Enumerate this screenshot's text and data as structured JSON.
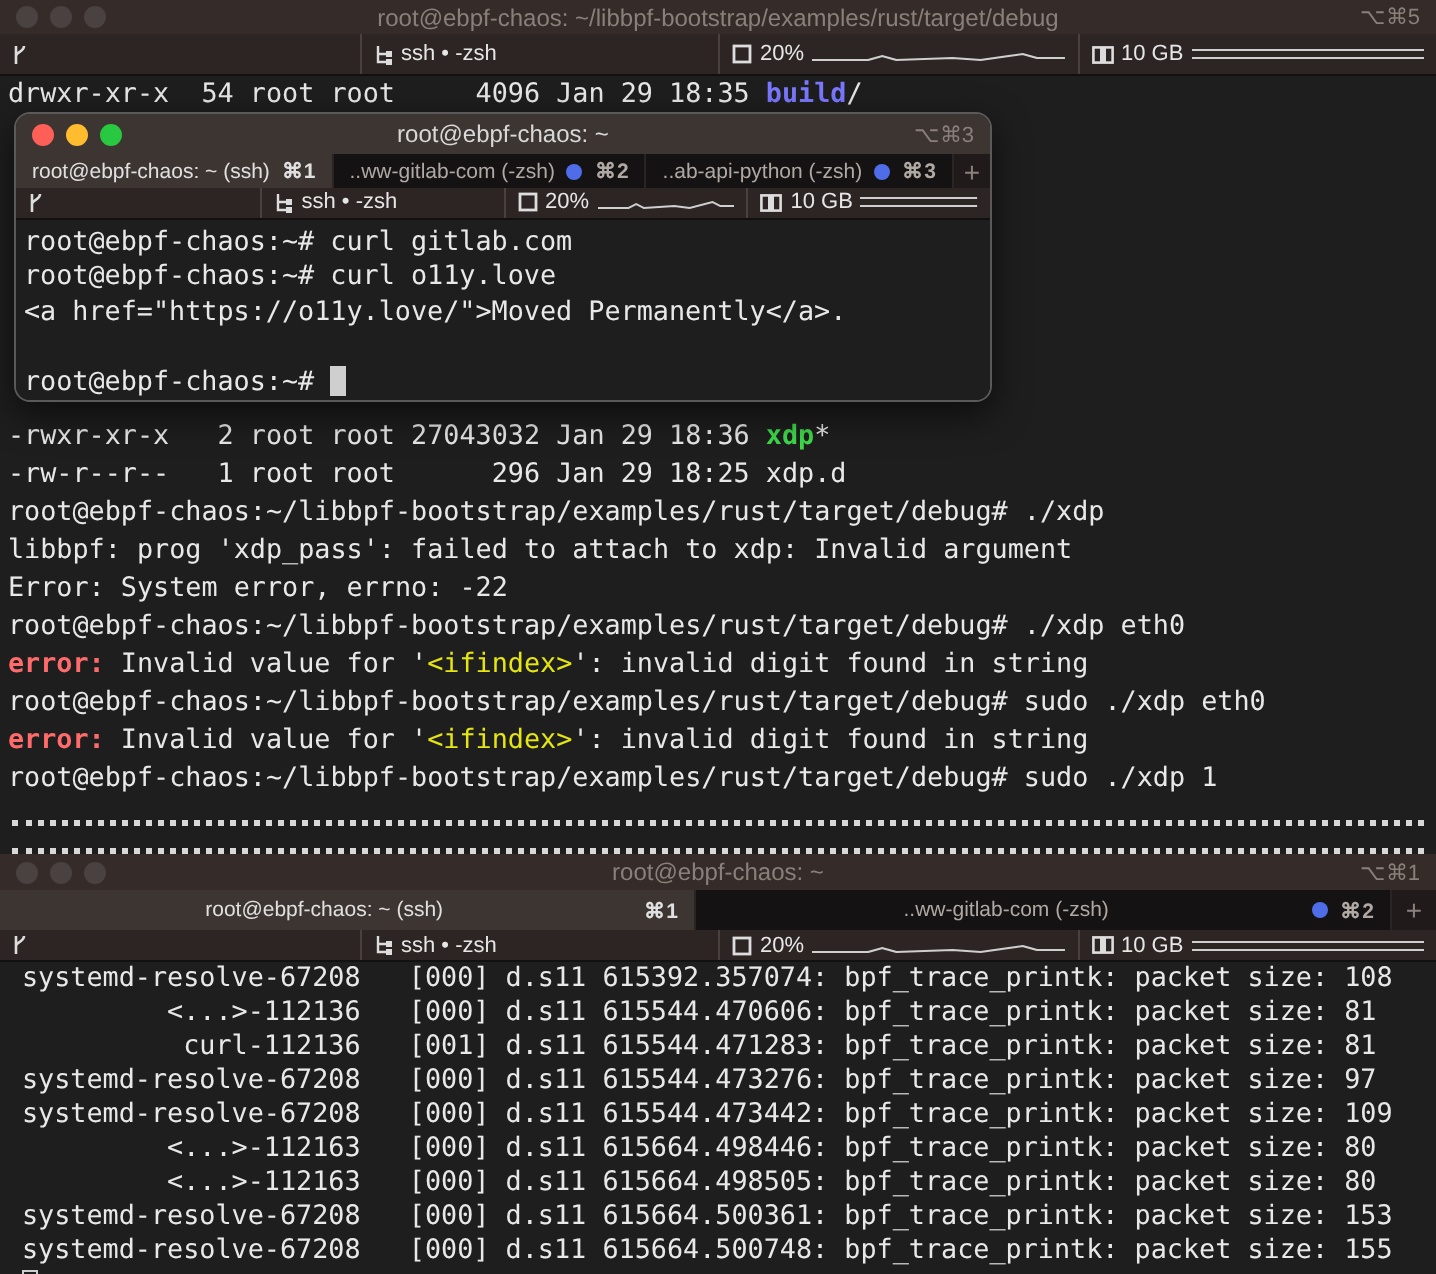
{
  "back_window": {
    "title": "root@ebpf-chaos: ~/libbpf-bootstrap/examples/rust/target/debug",
    "shortcut": "⌥⌘5",
    "focused": false,
    "status_bar": {
      "process": "ssh • -zsh",
      "cpu": "20%",
      "memory": "10 GB"
    },
    "top_lines": [
      [
        {
          "text": "drwxr-xr-x  54 root root     4096 Jan 29 18:35 ",
          "kind": "plain"
        },
        {
          "text": "build",
          "kind": "directory"
        },
        {
          "text": "/",
          "kind": "plain"
        }
      ]
    ],
    "lines": [
      [
        {
          "text": "-rwxr-xr-x   2 root root 27043032 Jan 29 18:36 ",
          "kind": "plain"
        },
        {
          "text": "xdp",
          "kind": "executable"
        },
        {
          "text": "*",
          "kind": "plain"
        }
      ],
      [
        {
          "text": "-rw-r--r--   1 root root      296 Jan 29 18:25 xdp.d",
          "kind": "plain"
        }
      ],
      [
        {
          "text": "root@ebpf-chaos:~/libbpf-bootstrap/examples/rust/target/debug# ./xdp",
          "kind": "plain"
        }
      ],
      [
        {
          "text": "libbpf: prog 'xdp_pass': failed to attach to xdp: Invalid argument",
          "kind": "plain"
        }
      ],
      [
        {
          "text": "Error: System error, errno: -22",
          "kind": "plain"
        }
      ],
      [
        {
          "text": "root@ebpf-chaos:~/libbpf-bootstrap/examples/rust/target/debug# ./xdp eth0",
          "kind": "plain"
        }
      ],
      [
        {
          "text": "error:",
          "kind": "error"
        },
        {
          "text": " Invalid value for '",
          "kind": "plain"
        },
        {
          "text": "<ifindex>",
          "kind": "highlight"
        },
        {
          "text": "': invalid digit found in string",
          "kind": "plain"
        }
      ],
      [
        {
          "text": "root@ebpf-chaos:~/libbpf-bootstrap/examples/rust/target/debug# sudo ./xdp eth0",
          "kind": "plain"
        }
      ],
      [
        {
          "text": "error:",
          "kind": "error"
        },
        {
          "text": " Invalid value for '",
          "kind": "plain"
        },
        {
          "text": "<ifindex>",
          "kind": "highlight"
        },
        {
          "text": "': invalid digit found in string",
          "kind": "plain"
        }
      ],
      [
        {
          "text": "root@ebpf-chaos:~/libbpf-bootstrap/examples/rust/target/debug# sudo ./xdp 1",
          "kind": "plain"
        }
      ]
    ]
  },
  "front_window": {
    "title": "root@ebpf-chaos: ~",
    "shortcut": "⌥⌘3",
    "focused": true,
    "tabs": [
      {
        "label": "root@ebpf-chaos: ~ (ssh)",
        "shortcut": "⌘1",
        "selected": true,
        "activity": false
      },
      {
        "label": "..ww-gitlab-com (-zsh)",
        "shortcut": "⌘2",
        "selected": false,
        "activity": true
      },
      {
        "label": "..ab-api-python (-zsh)",
        "shortcut": "⌘3",
        "selected": false,
        "activity": true
      }
    ],
    "new_tab": "+",
    "status_bar": {
      "process": "ssh • -zsh",
      "cpu": "20%",
      "memory": "10 GB"
    },
    "lines": [
      [
        {
          "text": "root@ebpf-chaos:~# curl gitlab.com",
          "kind": "plain"
        }
      ],
      [
        {
          "text": "root@ebpf-chaos:~# curl o11y.love",
          "kind": "plain"
        }
      ],
      [
        {
          "text": "<a href=\"https://o11y.love/\">Moved Permanently</a>.",
          "kind": "plain"
        }
      ]
    ],
    "prompt_line": [
      {
        "text": "root@ebpf-chaos:~# ",
        "kind": "plain"
      }
    ],
    "cursor": true
  },
  "bottom_window": {
    "title": "root@ebpf-chaos: ~",
    "shortcut": "⌥⌘1",
    "focused": false,
    "tabs": [
      {
        "label": "root@ebpf-chaos: ~ (ssh)",
        "shortcut": "⌘1",
        "selected": true,
        "activity": false
      },
      {
        "label": "..ww-gitlab-com (-zsh)",
        "shortcut": "⌘2",
        "selected": false,
        "activity": true
      }
    ],
    "new_tab": "+",
    "status_bar": {
      "process": "ssh • -zsh",
      "cpu": "20%",
      "memory": "10 GB"
    },
    "trace_rows": [
      {
        "task": "systemd-resolve-67208",
        "cpu": "[000]",
        "flags": "d.s11",
        "timestamp": "615392.357074:",
        "message": "bpf_trace_printk: packet size: 108"
      },
      {
        "task": "<...>-112136",
        "cpu": "[000]",
        "flags": "d.s11",
        "timestamp": "615544.470606:",
        "message": "bpf_trace_printk: packet size: 81"
      },
      {
        "task": "curl-112136",
        "cpu": "[001]",
        "flags": "d.s11",
        "timestamp": "615544.471283:",
        "message": "bpf_trace_printk: packet size: 81"
      },
      {
        "task": "systemd-resolve-67208",
        "cpu": "[000]",
        "flags": "d.s11",
        "timestamp": "615544.473276:",
        "message": "bpf_trace_printk: packet size: 97"
      },
      {
        "task": "systemd-resolve-67208",
        "cpu": "[000]",
        "flags": "d.s11",
        "timestamp": "615544.473442:",
        "message": "bpf_trace_printk: packet size: 109"
      },
      {
        "task": "<...>-112163",
        "cpu": "[000]",
        "flags": "d.s11",
        "timestamp": "615664.498446:",
        "message": "bpf_trace_printk: packet size: 80"
      },
      {
        "task": "<...>-112163",
        "cpu": "[000]",
        "flags": "d.s11",
        "timestamp": "615664.498505:",
        "message": "bpf_trace_printk: packet size: 80"
      },
      {
        "task": "systemd-resolve-67208",
        "cpu": "[000]",
        "flags": "d.s11",
        "timestamp": "615664.500361:",
        "message": "bpf_trace_printk: packet size: 153"
      },
      {
        "task": "systemd-resolve-67208",
        "cpu": "[000]",
        "flags": "d.s11",
        "timestamp": "615664.500748:",
        "message": "bpf_trace_printk: packet size: 155"
      }
    ],
    "cursor": true
  }
}
